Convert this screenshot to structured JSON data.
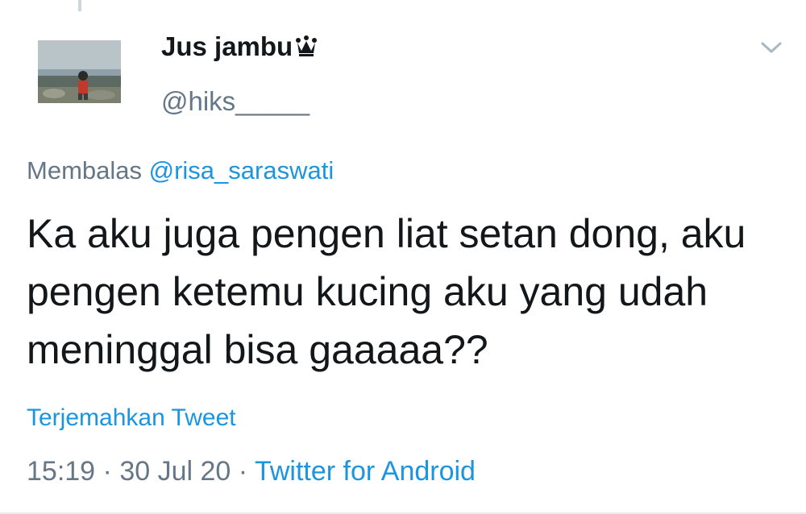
{
  "author": {
    "display_name": "Jus jambu",
    "badge_icon": "crown-icon",
    "handle": "@hiks_____",
    "avatar_icon": "profile-photo"
  },
  "reply": {
    "prefix": "Membalas",
    "mention": "@risa_saraswati"
  },
  "tweet": {
    "text": "Ka aku juga pengen liat setan dong, aku pengen ketemu kucing aku yang udah meninggal bisa gaaaaa??",
    "translate_label": "Terjemahkan Tweet",
    "time": "15:19",
    "date": "30 Jul 20",
    "source": "Twitter for Android",
    "separator": "·"
  },
  "colors": {
    "text": "#14171a",
    "secondary": "#657786",
    "link": "#1b95e0"
  },
  "icons": {
    "more_menu": "chevron-down-icon"
  }
}
